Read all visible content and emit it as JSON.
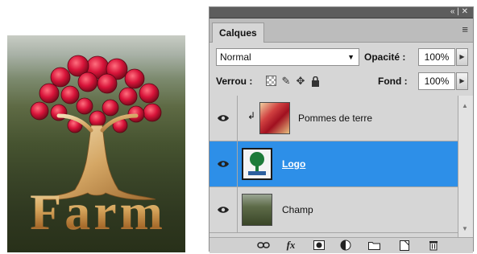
{
  "artwork": {
    "text": "Farm"
  },
  "panel": {
    "tab_label": "Calques",
    "titlebar_controls": "«  |  ✕",
    "menu_icon": "≡",
    "blend_mode": "Normal",
    "opacity_label": "Opacité :",
    "opacity_value": "100%",
    "lock_label": "Verrou :",
    "fill_label": "Fond :",
    "fill_value": "100%",
    "layers": [
      {
        "name": "Pommes de terre",
        "visible": true,
        "clipped": true,
        "selected": false
      },
      {
        "name": "Logo",
        "visible": true,
        "clipped": false,
        "selected": true
      },
      {
        "name": "Champ",
        "visible": true,
        "clipped": false,
        "selected": false
      }
    ],
    "bottom_icons": [
      "link-layers-icon",
      "fx-icon",
      "layer-mask-icon",
      "adjustment-layer-icon",
      "group-folder-icon",
      "new-layer-icon",
      "trash-icon"
    ],
    "fx_label": "fx"
  },
  "colors": {
    "selection": "#2d8fe8",
    "panel_bg": "#d6d6d6"
  }
}
